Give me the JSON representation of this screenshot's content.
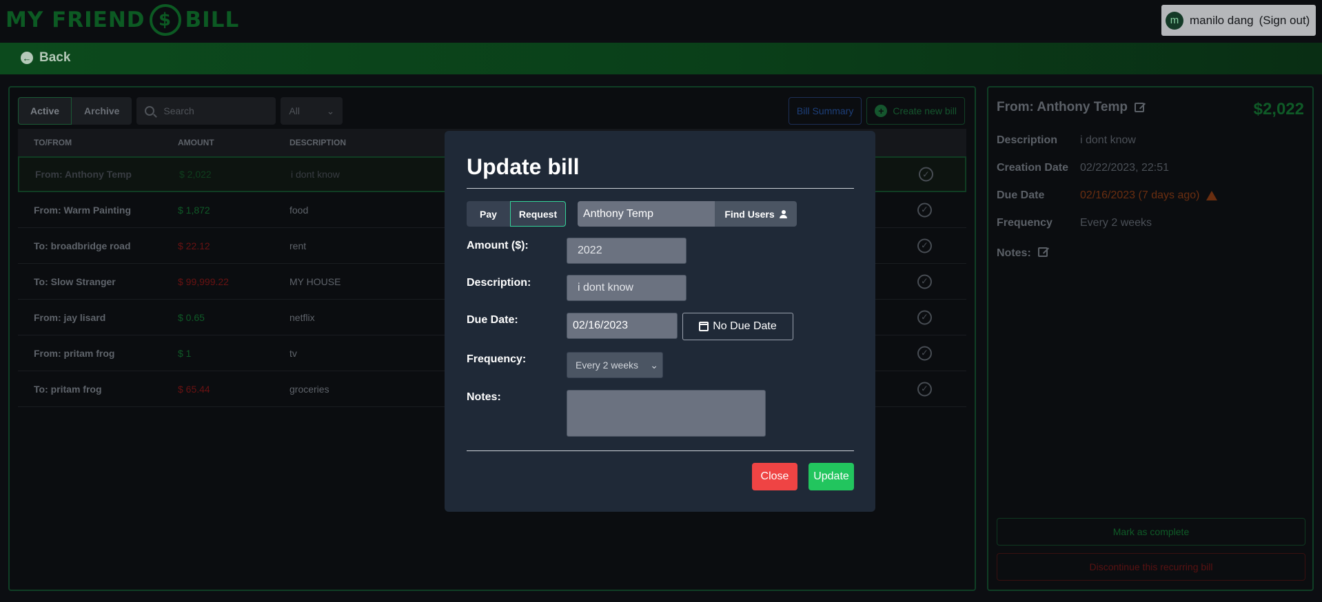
{
  "header": {
    "logo_left": "MY FRIEND",
    "logo_coin": "$",
    "logo_right": "BILL",
    "user_initial": "m",
    "user_name": "manilo dang",
    "sign_out": "(Sign out)"
  },
  "nav": {
    "back_label": "Back"
  },
  "bills": {
    "tabs": [
      {
        "label": "Active"
      },
      {
        "label": "Archive"
      }
    ],
    "search_placeholder": "Search",
    "filter_value": "All",
    "summary_label": "Bill Summary",
    "create_label": "Create new bill",
    "columns": {
      "to_from": "TO/FROM",
      "amount": "AMOUNT",
      "description": "DESCRIPTION"
    },
    "rows": [
      {
        "to_from": "From: Anthony Temp",
        "amount": "$ 2,022",
        "description": "i dont know"
      },
      {
        "to_from": "From: Warm Painting",
        "amount": "$ 1,872",
        "description": "food"
      },
      {
        "to_from": "To: broadbridge road",
        "amount": "$ 22.12",
        "description": "rent"
      },
      {
        "to_from": "To: Slow Stranger",
        "amount": "$ 99,999.22",
        "description": "MY HOUSE"
      },
      {
        "to_from": "From: jay lisard",
        "amount": "$ 0.65",
        "description": "netflix"
      },
      {
        "to_from": "From: pritam frog",
        "amount": "$ 1",
        "description": "tv"
      },
      {
        "to_from": "To: pritam frog",
        "amount": "$ 65.44",
        "description": "groceries"
      }
    ]
  },
  "details": {
    "title": "From: Anthony Temp",
    "amount": "$2,022",
    "description_label": "Description",
    "description_value": "i dont know",
    "creation_label": "Creation Date",
    "creation_value": "02/22/2023, 22:51",
    "due_label": "Due Date",
    "due_value": "02/16/2023 (7 days ago)",
    "frequency_label": "Frequency",
    "frequency_value": "Every 2 weeks",
    "notes_label": "Notes:",
    "mark_complete": "Mark as complete",
    "discontinue": "Discontinue this recurring bill"
  },
  "modal": {
    "title": "Update bill",
    "pay_label": "Pay",
    "request_label": "Request",
    "user_value": "Anthony Temp",
    "find_users": "Find Users",
    "amount_label": "Amount ($):",
    "amount_value": "2022",
    "description_label": "Description:",
    "description_value": "i dont know",
    "due_label": "Due Date:",
    "due_value": "02/16/2023",
    "no_due_label": "No Due Date",
    "frequency_label": "Frequency:",
    "frequency_value": "Every 2 weeks",
    "notes_label": "Notes:",
    "notes_value": "",
    "close_label": "Close",
    "update_label": "Update"
  },
  "colors": {
    "positive_amount": "#0f5a27",
    "negative_amount": "#6a1212",
    "accent_green": "#22c55e",
    "close_red": "#ef4444",
    "modal_bg": "#1f2937"
  }
}
